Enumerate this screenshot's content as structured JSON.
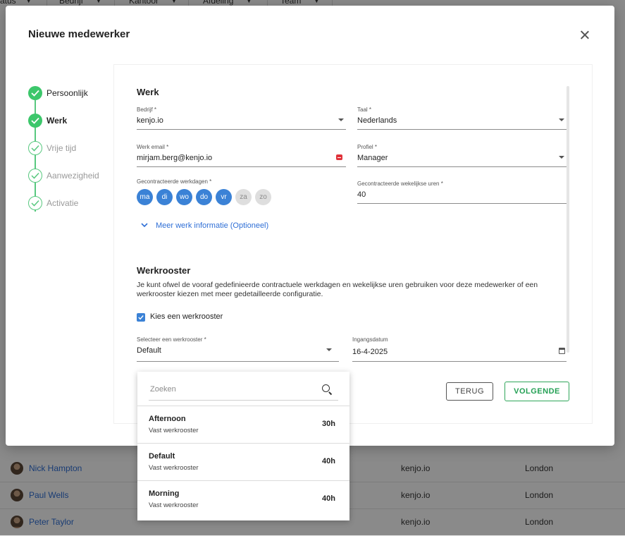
{
  "background": {
    "columns": [
      "atus",
      "Bedrijf",
      "Kantoor",
      "Afdeling",
      "Team"
    ],
    "rows": [
      {
        "name": "Nick Hampton",
        "company": "kenjo.io",
        "office": "London"
      },
      {
        "name": "Paul Wells",
        "company": "kenjo.io",
        "office": "London"
      },
      {
        "name": "Peter Taylor",
        "company": "kenjo.io",
        "office": "London"
      }
    ]
  },
  "dialog": {
    "title": "Nieuwe medewerker",
    "steps": [
      {
        "label": "Persoonlijk",
        "status": "done"
      },
      {
        "label": "Werk",
        "status": "active"
      },
      {
        "label": "Vrije tijd",
        "status": "todo"
      },
      {
        "label": "Aanwezigheid",
        "status": "todo"
      },
      {
        "label": "Activatie",
        "status": "todo"
      }
    ],
    "werk": {
      "title": "Werk",
      "company_label": "Bedrijf *",
      "company_value": "kenjo.io",
      "language_label": "Taal *",
      "language_value": "Nederlands",
      "email_label": "Werk email *",
      "email_value": "mirjam.berg@kenjo.io",
      "profile_label": "Profiel *",
      "profile_value": "Manager",
      "workdays_label": "Gecontracteerde werkdagen *",
      "workdays": [
        {
          "label": "ma",
          "selected": true
        },
        {
          "label": "di",
          "selected": true
        },
        {
          "label": "wo",
          "selected": true
        },
        {
          "label": "do",
          "selected": true
        },
        {
          "label": "vr",
          "selected": true
        },
        {
          "label": "za",
          "selected": false
        },
        {
          "label": "zo",
          "selected": false
        }
      ],
      "hours_label": "Gecontracteerde wekelijkse uren *",
      "hours_value": "40",
      "more_link": "Meer werk informatie (Optioneel)"
    },
    "werkrooster": {
      "title": "Werkrooster",
      "description": "Je kunt ofwel de vooraf gedefinieerde contractuele werkdagen en wekelijkse uren gebruiken voor deze medewerker of een werkrooster kiezen met meer gedetailleerde configuratie.",
      "checkbox_label": "Kies een werkrooster",
      "checkbox_checked": true,
      "select_label": "Selecteer een werkrooster *",
      "select_value": "Default",
      "date_label": "Ingangsdatum",
      "date_value": "16-4-2025"
    },
    "buttons": {
      "back": "TERUG",
      "next": "VOLGENDE"
    }
  },
  "dropdown": {
    "search_placeholder": "Zoeken",
    "items": [
      {
        "name": "Afternoon",
        "type": "Vast werkrooster",
        "hours": "30h"
      },
      {
        "name": "Default",
        "type": "Vast werkrooster",
        "hours": "40h"
      },
      {
        "name": "Morning",
        "type": "Vast werkrooster",
        "hours": "40h"
      }
    ]
  },
  "colors": {
    "accent_blue": "#3b82d6",
    "step_green": "#3cc76b",
    "next_green": "#23a054",
    "error_red": "#e0323a"
  }
}
